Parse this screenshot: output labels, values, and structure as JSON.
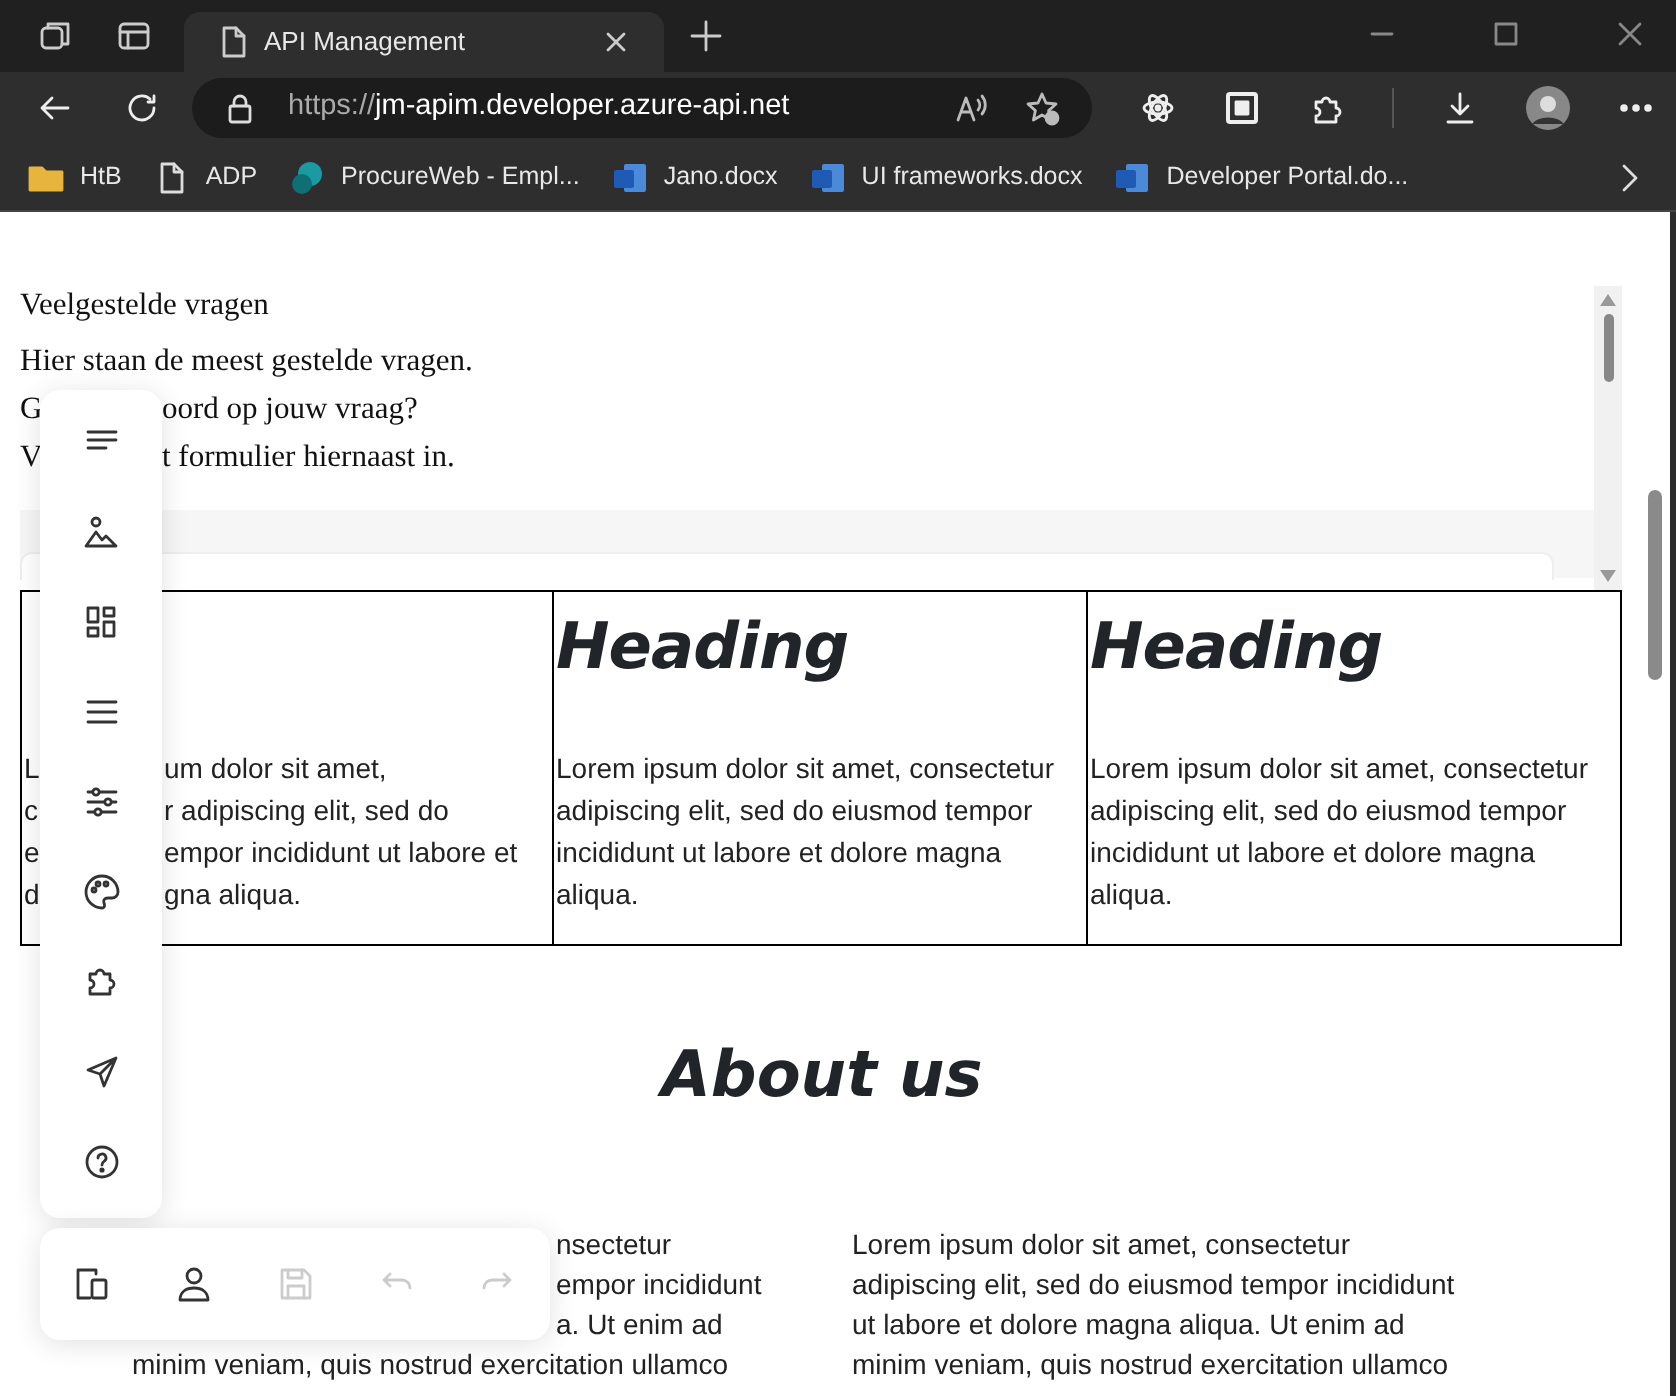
{
  "browser": {
    "tabs": [
      {
        "title": "API Management",
        "selected": true
      }
    ],
    "address": {
      "scheme": "https://",
      "host": "jm-apim.developer.azure-api.net"
    },
    "bookmarks": [
      {
        "label": "HtB",
        "kind": "folder"
      },
      {
        "label": "ADP",
        "kind": "page"
      },
      {
        "label": "ProcureWeb - Empl...",
        "kind": "sharepoint"
      },
      {
        "label": "Jano.docx",
        "kind": "word"
      },
      {
        "label": "UI frameworks.docx",
        "kind": "word"
      },
      {
        "label": "Developer Portal.do...",
        "kind": "word"
      }
    ]
  },
  "faq": {
    "title": "Veelgestelde vragen",
    "lines": [
      {
        "right": "Hier staan de meest gestelde vragen."
      },
      {
        "left": "G",
        "right": "oord op jouw vraag?"
      },
      {
        "left": "V",
        "right": "t formulier hiernaast in."
      }
    ]
  },
  "columns": [
    {
      "lines": [
        {
          "left": "L",
          "right": "um dolor sit amet,"
        },
        {
          "left": "c",
          "right": "r adipiscing elit, sed do"
        },
        {
          "left": "e",
          "right": "empor incididunt ut labore et"
        },
        {
          "left": "d",
          "right": "gna aliqua."
        }
      ]
    },
    {
      "heading": "Heading",
      "body": "Lorem ipsum dolor sit amet, consectetur adipiscing elit, sed do eiusmod tempor incididunt ut labore et dolore magna aliqua."
    },
    {
      "heading": "Heading",
      "body": "Lorem ipsum dolor sit amet, consectetur adipiscing elit, sed do eiusmod tempor incididunt ut labore et dolore magna aliqua."
    }
  ],
  "about": {
    "title": "About us",
    "left_lines": [
      "nsectetur",
      "empor incididunt",
      "a. Ut enim ad",
      "minim veniam, quis nostrud exercitation ullamco"
    ],
    "right_lines": [
      "Lorem ipsum dolor sit amet, consectetur",
      "adipiscing elit, sed do eiusmod tempor incididunt",
      "ut labore et dolore magna aliqua. Ut enim ad",
      "minim veniam, quis nostrud exercitation ullamco"
    ]
  },
  "side_toolbar": [
    {
      "kind": "text"
    },
    {
      "kind": "media"
    },
    {
      "kind": "layout"
    },
    {
      "kind": "menu"
    },
    {
      "kind": "settings"
    },
    {
      "kind": "styles"
    },
    {
      "kind": "widgets"
    },
    {
      "kind": "publish"
    },
    {
      "kind": "help"
    }
  ],
  "bottom_toolbar": [
    {
      "kind": "devices",
      "disabled": false
    },
    {
      "kind": "account",
      "disabled": false
    },
    {
      "kind": "save",
      "disabled": true
    },
    {
      "kind": "undo",
      "disabled": true
    },
    {
      "kind": "redo",
      "disabled": true
    }
  ]
}
